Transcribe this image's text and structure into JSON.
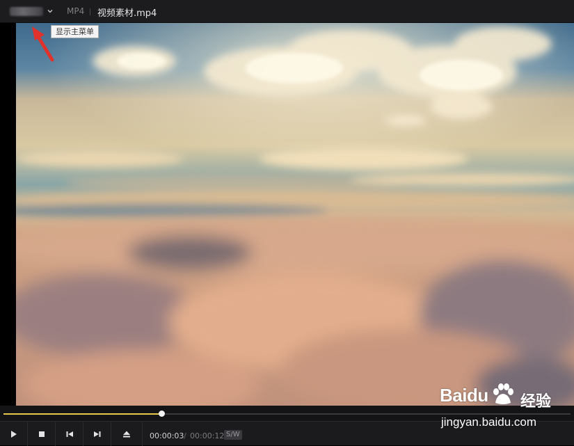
{
  "titlebar": {
    "format": "MP4",
    "filename": "视频素材.mp4",
    "menu_tooltip": "显示主菜单"
  },
  "player": {
    "progress": 0.278,
    "time_current": "00:00:03",
    "time_separator": "/",
    "time_total": "00:00:12",
    "sw_badge": "S/W"
  },
  "icons": {
    "menu": "chevron-down-icon",
    "play": "play-icon",
    "stop": "stop-icon",
    "prev": "skip-previous-icon",
    "next": "skip-next-icon",
    "eject": "eject-icon"
  },
  "colors": {
    "progress_fill": "#e8c84a",
    "annotation_arrow": "#e0312b"
  },
  "watermark": {
    "brand": "Baidu",
    "brand_cn": "经验",
    "url": "jingyan.baidu.com"
  }
}
